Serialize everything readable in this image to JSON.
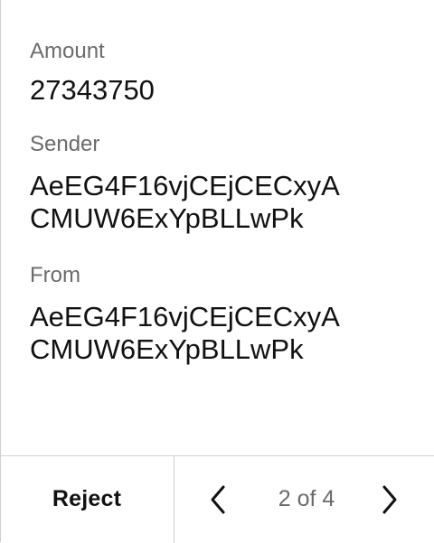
{
  "fields": {
    "amount": {
      "label": "Amount",
      "value": "27343750"
    },
    "sender": {
      "label": "Sender",
      "value": "AeEG4F16vjCEjCECxyA\nCMUW6ExYpBLLwPk"
    },
    "from": {
      "label": "From",
      "value": "AeEG4F16vjCEjCECxyA\nCMUW6ExYpBLLwPk"
    }
  },
  "footer": {
    "reject_label": "Reject",
    "page_indicator": "2 of 4",
    "prev_icon": "chevron-left-icon",
    "next_icon": "chevron-right-icon"
  },
  "colors": {
    "label_text": "#6b6b6b",
    "value_text": "#111111",
    "divider": "#cfcfcf",
    "background": "#ffffff"
  }
}
